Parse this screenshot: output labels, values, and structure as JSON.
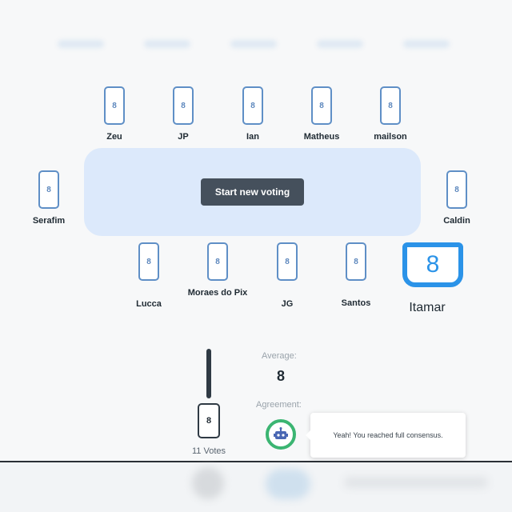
{
  "players_top": [
    {
      "name": "Zeu",
      "card": "8"
    },
    {
      "name": "JP",
      "card": "8"
    },
    {
      "name": "Ian",
      "card": "8"
    },
    {
      "name": "Matheus",
      "card": "8"
    },
    {
      "name": "mailson",
      "card": "8"
    }
  ],
  "players_side": [
    {
      "name": "Serafim",
      "card": "8"
    },
    {
      "name": "Caldin",
      "card": "8"
    }
  ],
  "players_bottom": [
    {
      "name": "Lucca",
      "card": "8"
    },
    {
      "name": "Moraes do Pix",
      "card": "8"
    },
    {
      "name": "JG",
      "card": "8"
    },
    {
      "name": "Santos",
      "card": "8"
    }
  ],
  "highlighted_player": {
    "name": "Itamar",
    "card": "8"
  },
  "table": {
    "start_button_label": "Start new voting"
  },
  "results": {
    "vote_card_value": "8",
    "votes_label": "11 Votes",
    "average_label": "Average:",
    "average_value": "8",
    "agreement_label": "Agreement:",
    "agreement_message": "Yeah! You reached full consensus."
  },
  "colors": {
    "card_border": "#5f8fc6",
    "table_bg": "#dce9fb",
    "button_bg": "#45505c",
    "highlight": "#2b93e8",
    "agreement_ring": "#3bb572"
  },
  "icons": {
    "agreement": "robot-icon"
  }
}
